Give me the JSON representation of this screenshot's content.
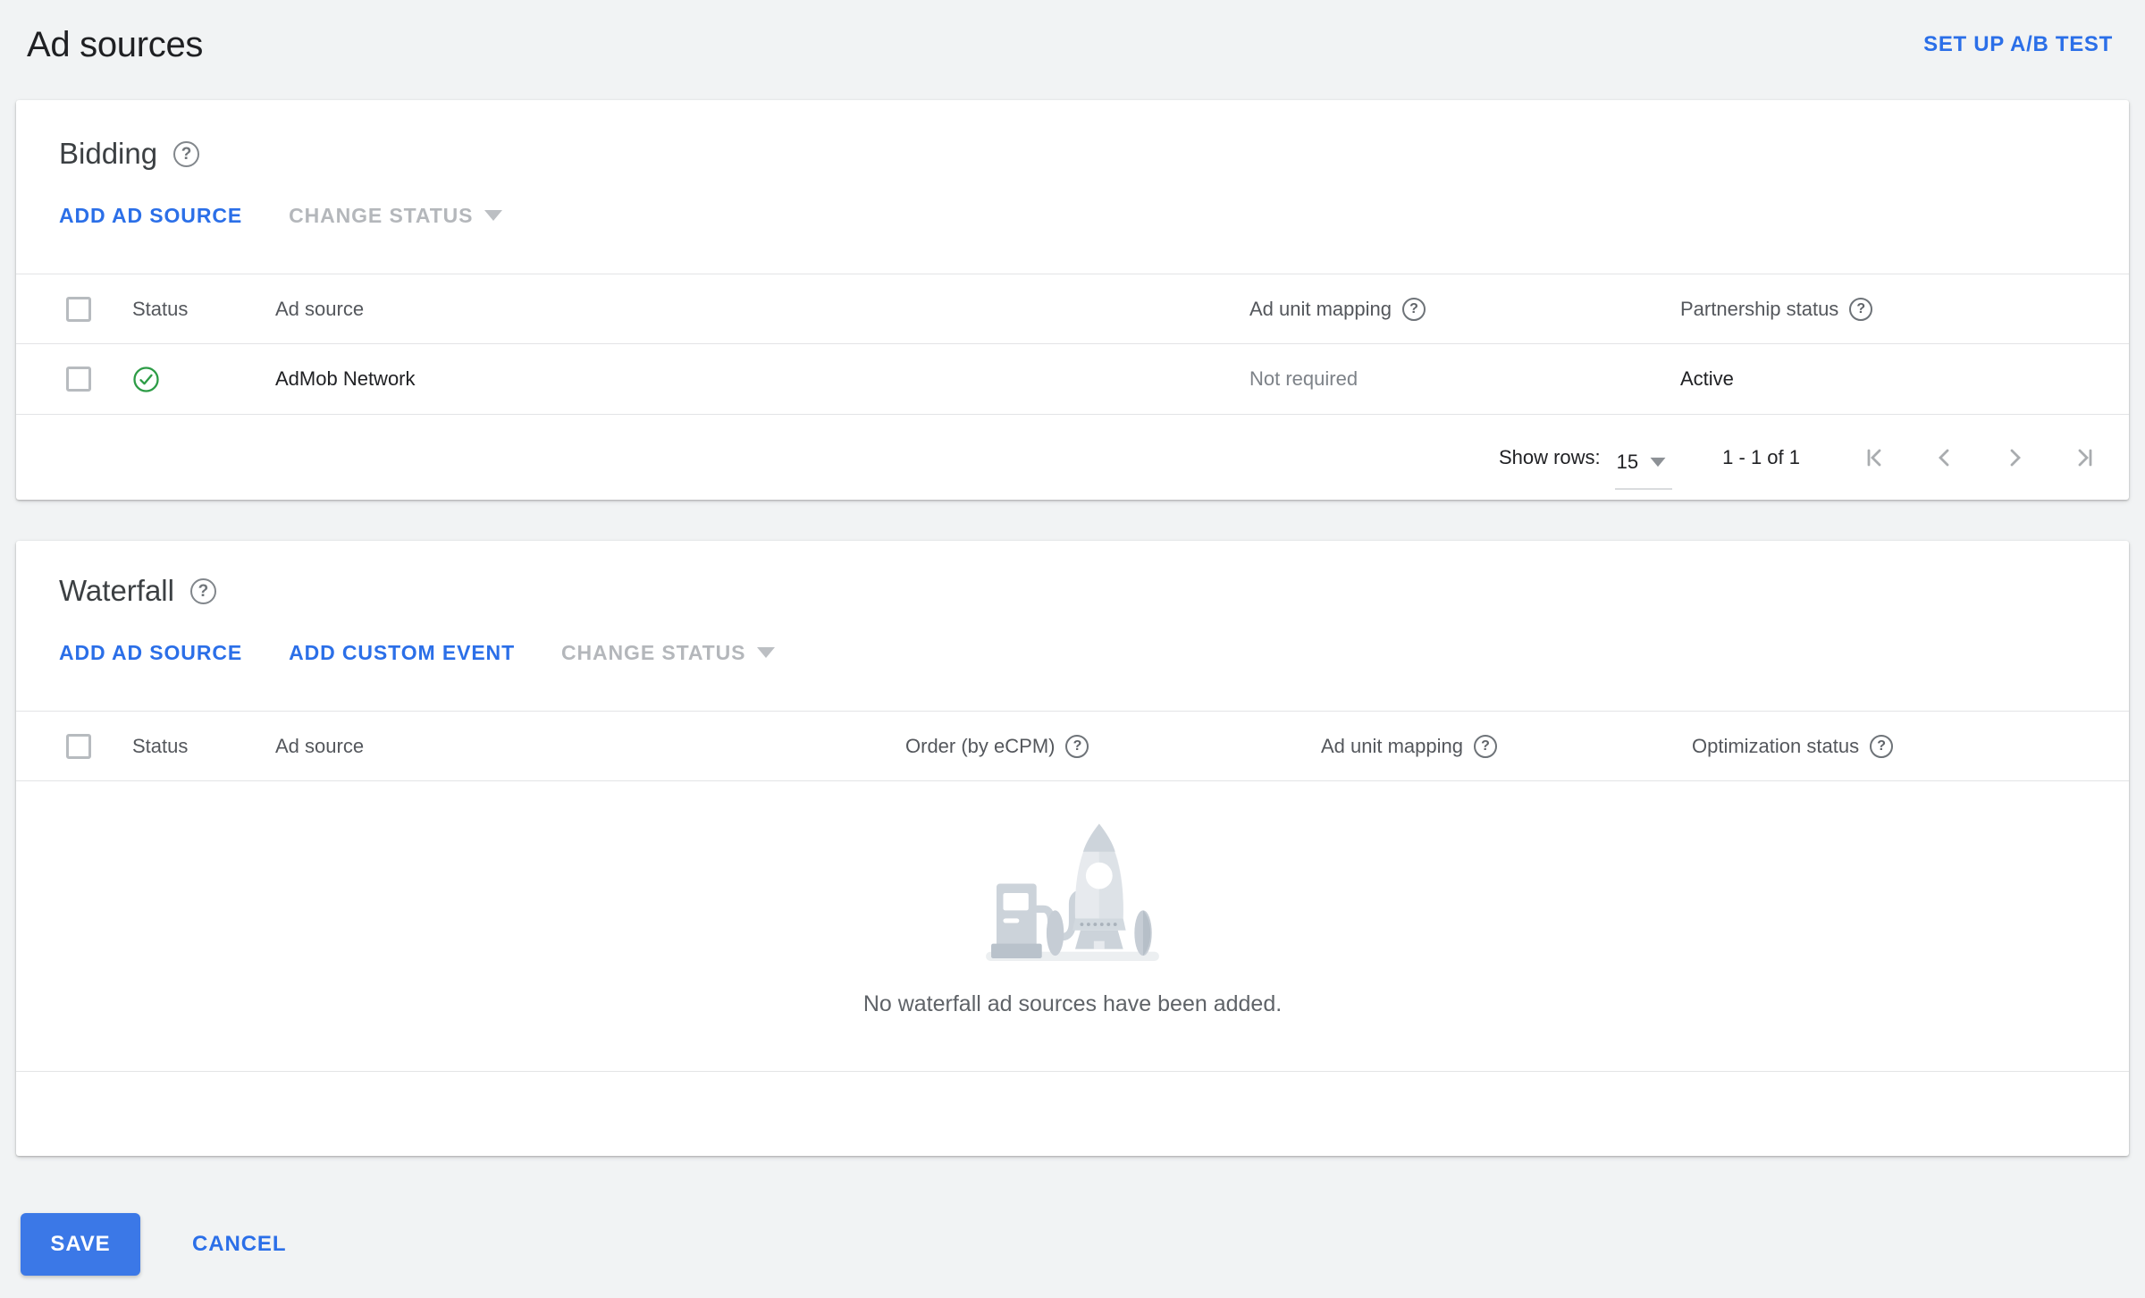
{
  "page": {
    "title": "Ad sources",
    "ab_test_label": "SET UP A/B TEST"
  },
  "bidding": {
    "title": "Bidding",
    "actions": {
      "add_ad_source": "ADD AD SOURCE",
      "change_status": "CHANGE STATUS"
    },
    "table": {
      "columns": {
        "status": "Status",
        "ad_source": "Ad source",
        "ad_unit_mapping": "Ad unit mapping",
        "partnership_status": "Partnership status"
      },
      "rows": [
        {
          "status_icon": "active-check",
          "ad_source": "AdMob Network",
          "ad_unit_mapping": "Not required",
          "partnership_status": "Active"
        }
      ]
    },
    "pagination": {
      "show_rows_label": "Show rows:",
      "rows_per_page": "15",
      "range": "1 - 1 of 1"
    }
  },
  "waterfall": {
    "title": "Waterfall",
    "actions": {
      "add_ad_source": "ADD AD SOURCE",
      "add_custom_event": "ADD CUSTOM EVENT",
      "change_status": "CHANGE STATUS"
    },
    "table": {
      "columns": {
        "status": "Status",
        "ad_source": "Ad source",
        "order": "Order (by eCPM)",
        "ad_unit_mapping": "Ad unit mapping",
        "optimization_status": "Optimization status"
      }
    },
    "empty_message": "No waterfall ad sources have been added."
  },
  "footer": {
    "save": "SAVE",
    "cancel": "CANCEL"
  },
  "icons": {
    "help_glyph": "?"
  },
  "colors": {
    "accent_blue": "#2b6fe8",
    "save_button_blue": "#3b78e7",
    "success_green": "#2d9c46",
    "disabled_grey": "#b4b7bb",
    "page_background": "#f1f3f4",
    "text_dark": "#202124",
    "text_muted": "#7d8288"
  }
}
